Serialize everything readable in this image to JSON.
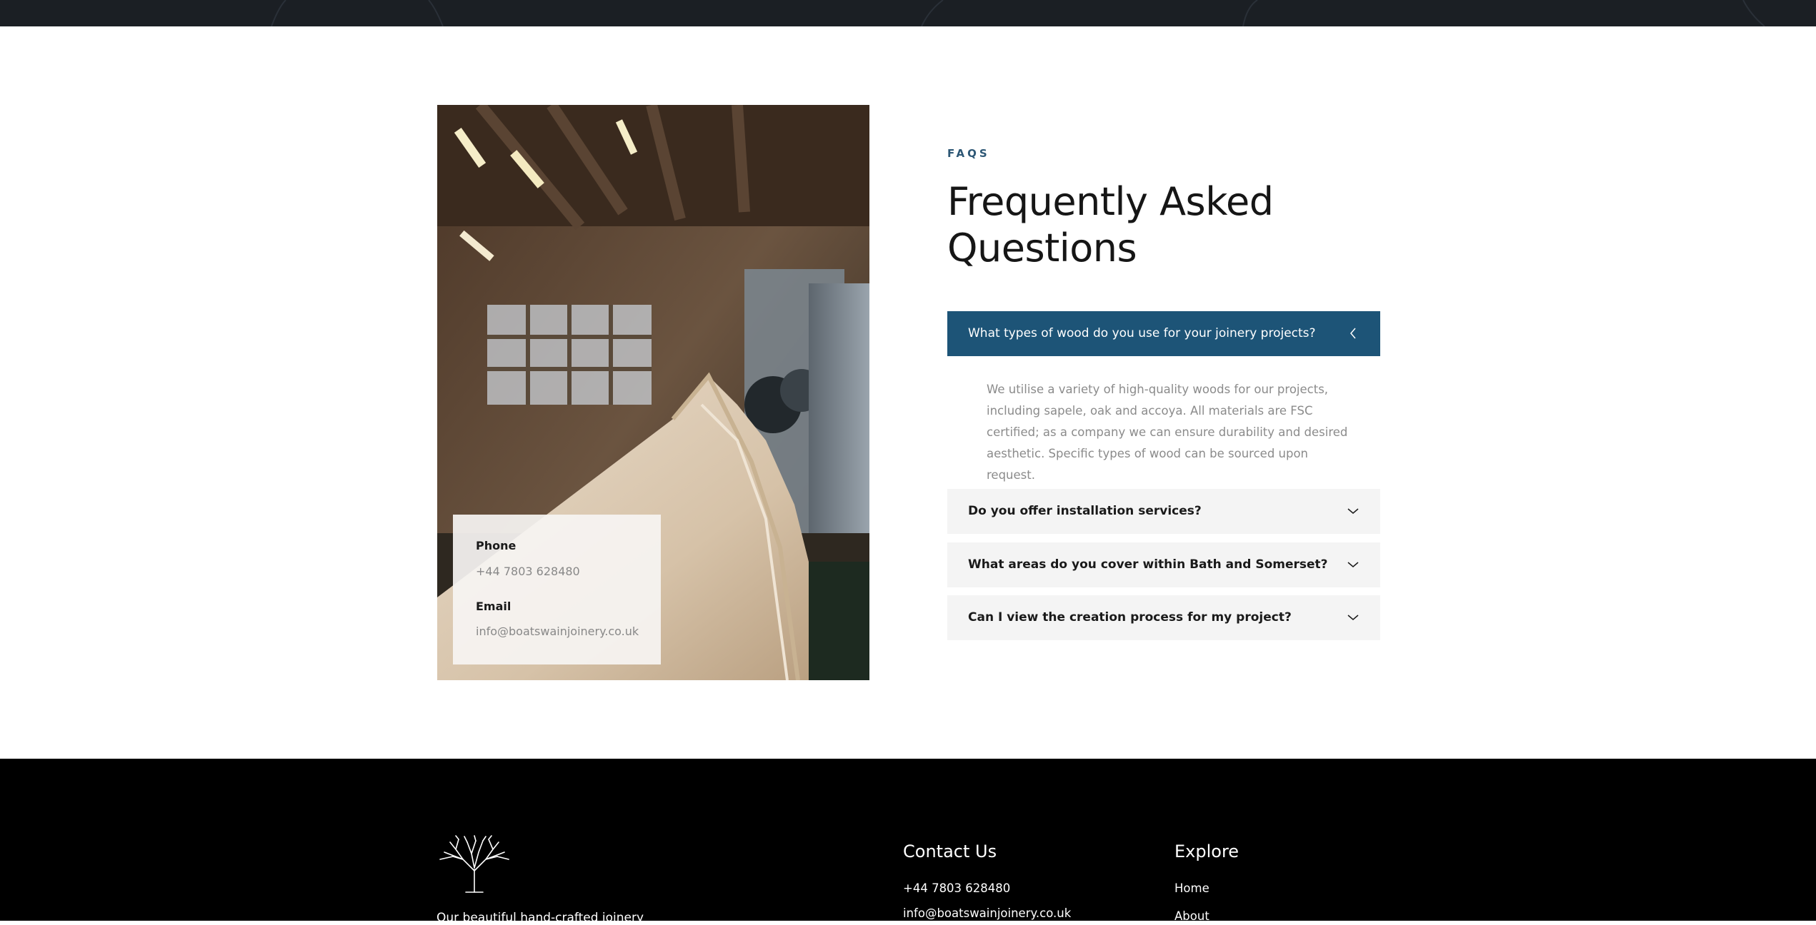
{
  "faq_section": {
    "eyebrow": "FAQS",
    "title": "Frequently Asked Questions",
    "contact_card": {
      "phone_label": "Phone",
      "phone_value": "+44 7803 628480",
      "email_label": "Email",
      "email_value": "info@boatswainjoinery.co.uk"
    },
    "items": [
      {
        "question": "What types of wood do you use for your joinery projects?",
        "answer": "We utilise a variety of high-quality woods for our projects, including sapele, oak and accoya. All materials are FSC certified; as a company we can ensure durability and desired aesthetic. Specific types of wood can be sourced upon request.",
        "expanded": true
      },
      {
        "question": "Do you offer installation services?",
        "expanded": false
      },
      {
        "question": "What areas do you cover within Bath and Somerset?",
        "expanded": false
      },
      {
        "question": "Can I view the creation process for my project?",
        "expanded": false
      }
    ]
  },
  "footer": {
    "tagline": "Our beautiful hand-crafted joinery",
    "contact": {
      "heading": "Contact Us",
      "phone": "+44 7803 628480",
      "email": "info@boatswainjoinery.co.uk"
    },
    "explore": {
      "heading": "Explore",
      "links": [
        "Home",
        "About"
      ]
    }
  },
  "colors": {
    "accent": "#1d5477",
    "eyebrow": "#2d5775",
    "footer_bg": "#000000",
    "topbar_bg": "#1b1f24"
  },
  "icons": {
    "expanded_chevron": "chevron-left-icon",
    "collapsed_chevron": "chevron-down-icon",
    "logo": "tree-logo-icon"
  }
}
